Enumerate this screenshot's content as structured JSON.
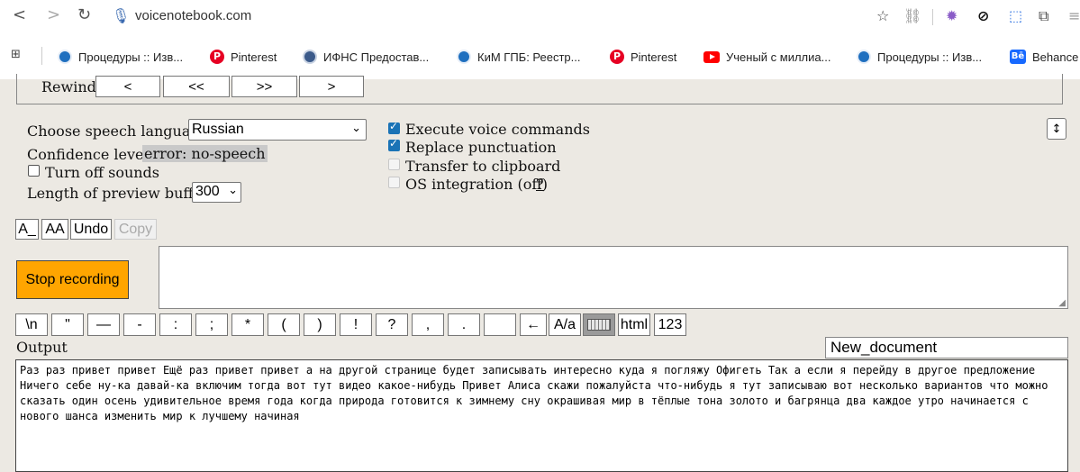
{
  "browser": {
    "url": "voicenotebook.com",
    "bookmarks": [
      {
        "label": "Процедуры :: Изв...",
        "icon": "globe-icon"
      },
      {
        "label": "Pinterest",
        "icon": "pinterest-icon"
      },
      {
        "label": "ИФНС Предостав...",
        "icon": "fns-icon"
      },
      {
        "label": "КиМ ГПБ: Реестр...",
        "icon": "globe-icon"
      },
      {
        "label": "Pinterest",
        "icon": "pinterest-icon"
      },
      {
        "label": "Ученый с миллиа...",
        "icon": "youtube-icon"
      },
      {
        "label": "Процедуры :: Изв...",
        "icon": "globe-icon"
      },
      {
        "label": "Behance",
        "icon": "behance-icon"
      }
    ]
  },
  "rewind": {
    "label": "Rewind",
    "buttons": [
      "<",
      "<<",
      ">>",
      ">"
    ]
  },
  "settings": {
    "language_label": "Choose speech language",
    "language_value": "Russian",
    "confidence_label": "Confidence level",
    "confidence_value": "error: no-speech",
    "turn_off_sounds": "Turn off sounds",
    "preview_label": "Length of preview buffer",
    "preview_value": "300",
    "execute_commands": "Execute voice commands",
    "replace_punctuation": "Replace punctuation",
    "transfer_clipboard": "Transfer to clipboard",
    "os_integration": "OS integration (off)",
    "os_help": "?"
  },
  "toolbar": {
    "a_underscore": "A_",
    "aa": "AA",
    "undo": "Undo",
    "copy": "Copy"
  },
  "recording": {
    "stop_label": "Stop recording"
  },
  "symbols": [
    "\\n",
    "\"",
    "—",
    "-",
    ":",
    ";",
    "*",
    "(",
    ")",
    "!",
    "?",
    ",",
    ".",
    "",
    "←",
    "A/a",
    "",
    "html",
    "123"
  ],
  "output": {
    "label": "Output",
    "document_name": "New_document",
    "text": "Раз раз привет привет Ещё раз привет привет а на другой странице будет записывать интересно куда я погляжу Офигеть Так а если я перейду в другое предложение Ничего себе ну-ка давай-ка включим тогда вот тут видео какое-нибудь Привет Алиса скажи пожалуйста что-нибудь я тут записываю вот несколько вариантов что можно сказать один осень удивительное время года когда природа готовится к зимнему сну окрашивая мир в тёплые тона золото и багрянца два каждое утро начинается с нового шанса изменить мир к лучшему начиная"
  },
  "colors": {
    "page_bg": "#ece9e3",
    "stop_button": "#ffa500",
    "checkbox_accent": "#1a73b6",
    "confidence_highlight": "#c9c9c9"
  }
}
